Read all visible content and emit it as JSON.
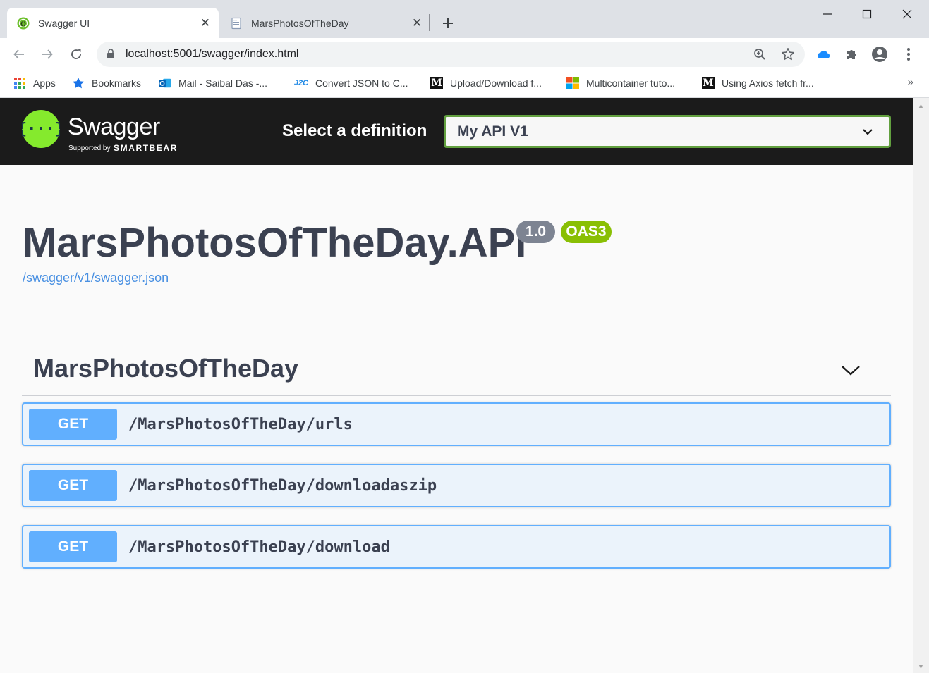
{
  "browser": {
    "tabs": [
      {
        "title": "Swagger UI",
        "active": true,
        "icon": "swagger-favicon"
      },
      {
        "title": "MarsPhotosOfTheDay",
        "active": false,
        "icon": "page-favicon"
      }
    ],
    "url": "localhost:5001/swagger/index.html",
    "bookmarks": [
      {
        "label": "Apps",
        "icon": "apps-grid-icon"
      },
      {
        "label": "Bookmarks",
        "icon": "star-icon"
      },
      {
        "label": "Mail - Saibal Das -...",
        "icon": "outlook-icon"
      },
      {
        "label": "Convert JSON to C...",
        "icon": "j2c-icon"
      },
      {
        "label": "Upload/Download f...",
        "icon": "medium-icon"
      },
      {
        "label": "Multicontainer tuto...",
        "icon": "microsoft-icon"
      },
      {
        "label": "Using Axios fetch fr...",
        "icon": "medium-icon"
      }
    ],
    "bookmarks_more": "»"
  },
  "swagger": {
    "wordmark": "Swagger",
    "supported_by": "Supported by",
    "smartbear": "SMARTBEAR",
    "select_label": "Select a definition",
    "selected_definition": "My API V1",
    "api_title": "MarsPhotosOfTheDay.API",
    "version_badge": "1.0",
    "oas_badge": "OAS3",
    "spec_link": "/swagger/v1/swagger.json",
    "tag": "MarsPhotosOfTheDay",
    "operations": [
      {
        "method": "GET",
        "path": "/MarsPhotosOfTheDay/urls"
      },
      {
        "method": "GET",
        "path": "/MarsPhotosOfTheDay/downloadaszip"
      },
      {
        "method": "GET",
        "path": "/MarsPhotosOfTheDay/download"
      }
    ]
  },
  "colors": {
    "get_method": "#61affe",
    "get_bg": "#ebf3fb",
    "topbar": "#1b1b1b",
    "oas_badge": "#89bf04",
    "version_badge": "#7d8492",
    "link": "#4990e2",
    "select_border": "#62a03f"
  }
}
